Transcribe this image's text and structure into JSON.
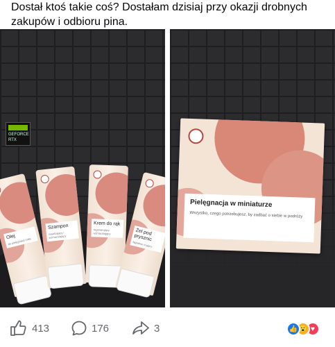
{
  "post": {
    "text": "Dostał ktoś takie coś? Dostałam dzisiaj przy okazji drobnych zakupów i odbioru pina."
  },
  "photos": {
    "left": {
      "sticker": "GEFORCE RTX",
      "tubes": [
        {
          "name": "Olej",
          "sub": "do pielęgnacji ciała"
        },
        {
          "name": "Szampon",
          "sub": "nawilżający i wzmacniający"
        },
        {
          "name": "Krem do rąk",
          "sub": "regenerujący wzmacniający"
        },
        {
          "name": "Żel pod prysznic",
          "sub": "łagodnie myjący"
        }
      ]
    },
    "right": {
      "box_title": "Pielęgnacja w miniaturze",
      "box_subtitle": "Wszystko, czego potrzebujesz, by zadbać o siebie w podróży"
    }
  },
  "actions": {
    "like_count": "413",
    "comment_count": "176",
    "share_count": "3"
  },
  "reactions": [
    "like",
    "wow",
    "love"
  ],
  "colors": {
    "facebook_blue": "#1877f2",
    "wow_yellow": "#f7b125",
    "love_red": "#f33e58",
    "coral": "#d98b80"
  }
}
